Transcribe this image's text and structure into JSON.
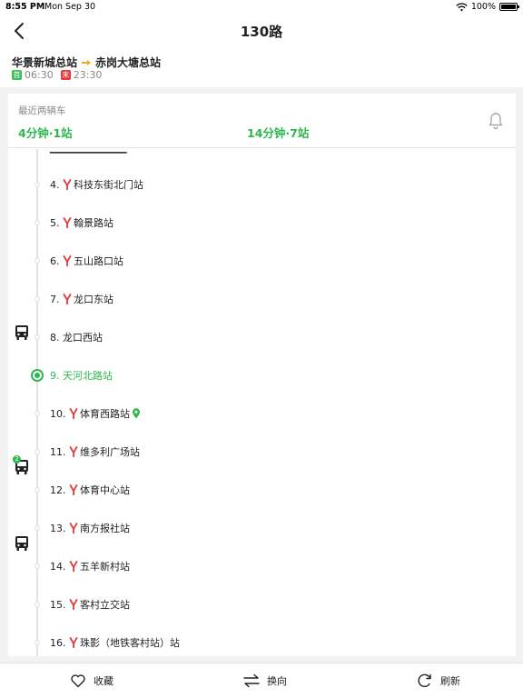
{
  "status": {
    "time": "8:55 PM",
    "date": "Mon Sep 30",
    "battery": "100%"
  },
  "nav": {
    "title": "130路"
  },
  "route": {
    "from": "华景新城总站",
    "to": "赤岗大塘总站",
    "start_tag": "首",
    "first_time": "06:30",
    "end_tag": "末",
    "last_time": "23:30"
  },
  "recent": {
    "label": "最近两辆车",
    "bus1": "4分钟·1站",
    "bus2": "14分钟·7站"
  },
  "stops": [
    {
      "label": "4. ",
      "name": "科技东街北门站",
      "metro": true
    },
    {
      "label": "5. ",
      "name": "翰景路站",
      "metro": true
    },
    {
      "label": "6. ",
      "name": "五山路口站",
      "metro": true
    },
    {
      "label": "7. ",
      "name": "龙口东站",
      "metro": true
    },
    {
      "label": "8. ",
      "name": "龙口西站",
      "metro": false
    },
    {
      "label": "9. ",
      "name": "天河北路站",
      "metro": false,
      "current": true
    },
    {
      "label": "10. ",
      "name": "体育西路站",
      "metro": true,
      "pin": true
    },
    {
      "label": "11. ",
      "name": "维多利广场站",
      "metro": true
    },
    {
      "label": "12. ",
      "name": "体育中心站",
      "metro": true
    },
    {
      "label": "13. ",
      "name": "南方报社站",
      "metro": true
    },
    {
      "label": "14. ",
      "name": "五羊新村站",
      "metro": true
    },
    {
      "label": "15. ",
      "name": "客村立交站",
      "metro": true
    },
    {
      "label": "16. ",
      "name": "珠影（地铁客村站）站",
      "metro": true
    }
  ],
  "buses": {
    "count_badge": "2"
  },
  "toolbar": {
    "favorite": "收藏",
    "reverse": "换向",
    "refresh": "刷新"
  },
  "colors": {
    "accent": "#2db84d",
    "metro": "#e33b3b",
    "arrow": "#f0a81c"
  }
}
